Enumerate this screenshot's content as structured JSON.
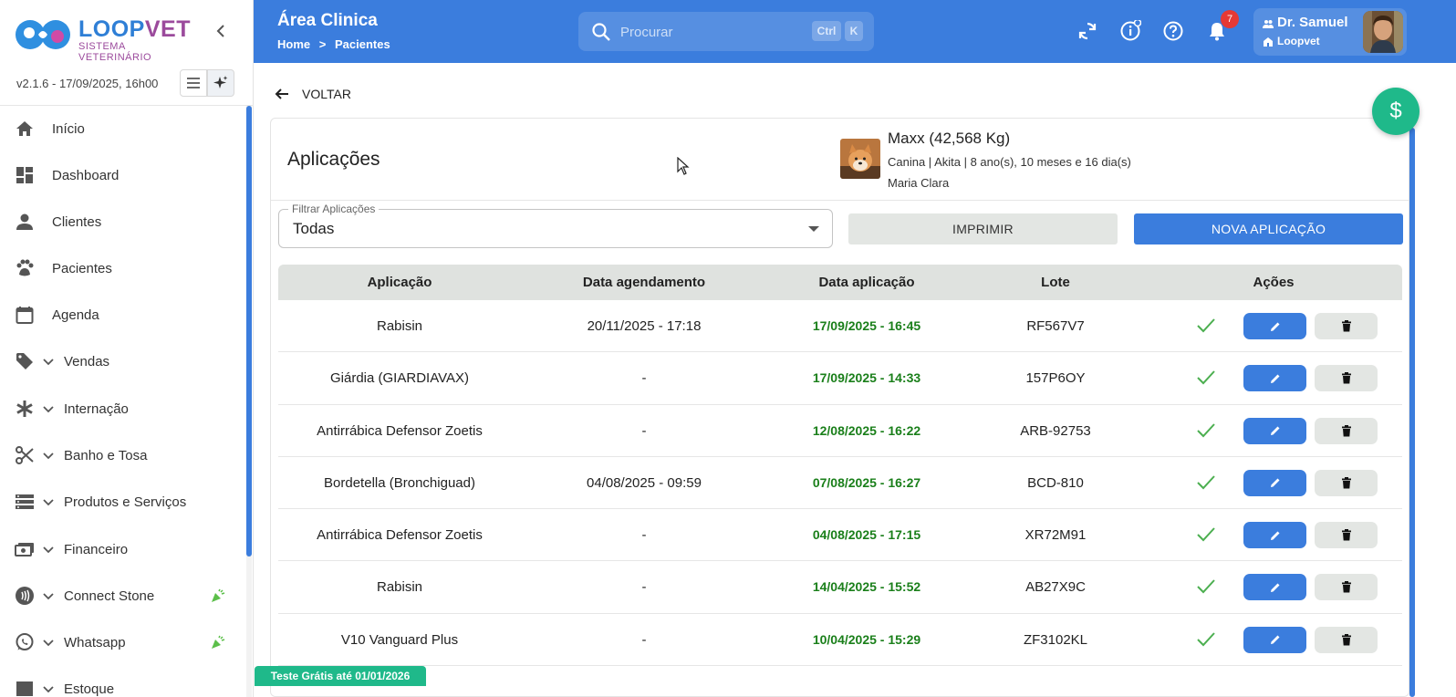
{
  "brand": {
    "name_part1": "LOOP",
    "name_part2": "VET",
    "subtitle": "SISTEMA VETERINÁRIO",
    "primary_color": "#3b7ddd",
    "accent_color": "#9b4a9c"
  },
  "version_text": "v2.1.6 - 17/09/2025, 16h00",
  "sidebar": {
    "items": [
      {
        "label": "Início",
        "icon": "home-icon"
      },
      {
        "label": "Dashboard",
        "icon": "dashboard-icon"
      },
      {
        "label": "Clientes",
        "icon": "person-icon"
      },
      {
        "label": "Pacientes",
        "icon": "paw-icon"
      },
      {
        "label": "Agenda",
        "icon": "calendar-icon"
      },
      {
        "label": "Vendas",
        "icon": "tag-icon"
      },
      {
        "label": "Internação",
        "icon": "asterisk-icon"
      },
      {
        "label": "Banho e Tosa",
        "icon": "scissors-icon"
      },
      {
        "label": "Produtos e Serviços",
        "icon": "storage-icon"
      },
      {
        "label": "Financeiro",
        "icon": "money-icon"
      },
      {
        "label": "Connect Stone",
        "icon": "contactless-icon"
      },
      {
        "label": "Whatsapp",
        "icon": "whatsapp-icon"
      },
      {
        "label": "Estoque",
        "icon": "box-icon"
      }
    ]
  },
  "topbar": {
    "title": "Área Clinica",
    "breadcrumb": [
      "Home",
      ">",
      "Pacientes"
    ],
    "search_placeholder": "Procurar",
    "shortcut_ctrl": "Ctrl",
    "shortcut_key": "K",
    "notification_count": "7",
    "user_name": "Dr. Samuel",
    "user_org": "Loopvet"
  },
  "main": {
    "back_label": "VOLTAR",
    "title": "Aplicações",
    "pet": {
      "name": "Maxx (42,568 Kg)",
      "info": "Canina | Akita | 8 ano(s), 10 meses e 16 dia(s)",
      "owner": "Maria Clara"
    },
    "filter": {
      "label": "Filtrar Aplicações",
      "value": "Todas"
    },
    "print_label": "IMPRIMIR",
    "new_label": "NOVA APLICAÇÃO",
    "fab_symbol": "$",
    "trial_text": "Teste Grátis até 01/01/2026"
  },
  "table": {
    "headers": [
      "Aplicação",
      "Data agendamento",
      "Data aplicação",
      "Lote",
      "Ações"
    ],
    "rows": [
      {
        "aplicacao": "Rabisin",
        "agendamento": "20/11/2025 - 17:18",
        "data": "17/09/2025 - 16:45",
        "lote": "RF567V7"
      },
      {
        "aplicacao": "Giárdia (GIARDIAVAX)",
        "agendamento": "-",
        "data": "17/09/2025 - 14:33",
        "lote": "157P6OY"
      },
      {
        "aplicacao": "Antirrábica Defensor Zoetis",
        "agendamento": "-",
        "data": "12/08/2025 - 16:22",
        "lote": "ARB-92753"
      },
      {
        "aplicacao": "Bordetella (Bronchiguad)",
        "agendamento": "04/08/2025 - 09:59",
        "data": "07/08/2025 - 16:27",
        "lote": "BCD-810"
      },
      {
        "aplicacao": "Antirrábica Defensor Zoetis",
        "agendamento": "-",
        "data": "04/08/2025 - 17:15",
        "lote": "XR72M91"
      },
      {
        "aplicacao": "Rabisin",
        "agendamento": "-",
        "data": "14/04/2025 - 15:52",
        "lote": "AB27X9C"
      },
      {
        "aplicacao": "V10 Vanguard Plus",
        "agendamento": "-",
        "data": "10/04/2025 - 15:29",
        "lote": "ZF3102KL"
      }
    ]
  }
}
